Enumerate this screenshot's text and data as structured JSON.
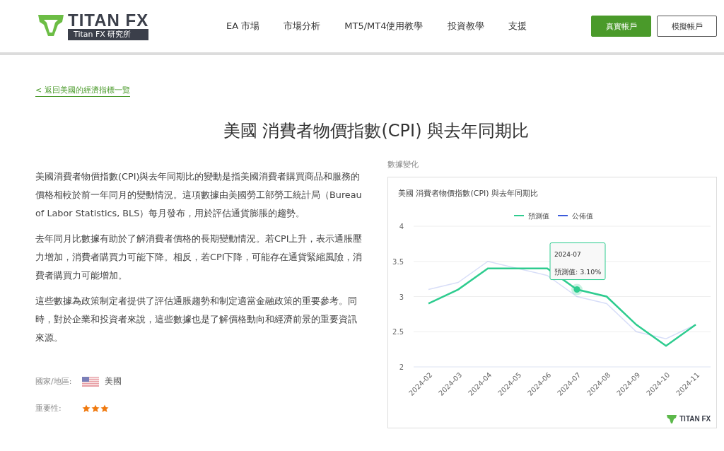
{
  "header": {
    "logo": {
      "brand": "TITAN FX",
      "tagline": "Titan FX 研究所"
    },
    "nav": [
      {
        "label": "EA 市場"
      },
      {
        "label": "市場分析"
      },
      {
        "label": "MT5/MT4使用教學"
      },
      {
        "label": "投資教學"
      },
      {
        "label": "支援"
      }
    ],
    "buttons": [
      {
        "label": "真實帳戶",
        "kind": "primary"
      },
      {
        "label": "模擬帳戶",
        "kind": "outline"
      }
    ]
  },
  "back_link": "< 返回美國的經濟指標一覽",
  "title": "美國 消費者物價指數(CPI) 與去年同期比",
  "paragraphs": [
    "美國消費者物價指數(CPI)與去年同期比的變動是指美國消費者購買商品和服務的價格相較於前一年同月的變動情況。這項數據由美國勞工部勞工統計局（Bureau of Labor Statistics, BLS）每月發布，用於評估通貨膨脹的趨勢。",
    "去年同月比數據有助於了解消費者價格的長期變動情況。若CPI上升，表示通脹壓力增加，消費者購買力可能下降。相反，若CPI下降，可能存在通貨緊縮風險，消費者購買力可能增加。",
    "這些數據為政策制定者提供了評估通脹趨勢和制定適當金融政策的重要參考。同時，對於企業和投資者來說，這些數據也是了解價格動向和經濟前景的重要資訊來源。"
  ],
  "meta": {
    "country_label": "國家/地區:",
    "country": "美國",
    "importance_label": "重要性:",
    "stars": 3
  },
  "chart": {
    "section_label": "數據變化",
    "brand": "TITAN FX",
    "tooltip": {
      "category": "2024-07",
      "text": "預測值: 3.10%"
    },
    "chart_data": {
      "type": "line",
      "title": "美國 消費者物價指數(CPI) 與去年同期比",
      "grid": true,
      "legend": true,
      "categories": [
        "2024-02",
        "2024-03",
        "2024-04",
        "2024-05",
        "2024-06",
        "2024-07",
        "2024-08",
        "2024-09",
        "2024-10",
        "2024-11"
      ],
      "ylim": [
        2,
        4
      ],
      "yticks": [
        2,
        2.5,
        3,
        3.5,
        4
      ],
      "series": [
        {
          "name": "預測值",
          "color": "#2ecc8f",
          "values": [
            2.9,
            3.1,
            3.4,
            3.4,
            3.4,
            3.1,
            3.0,
            2.6,
            2.3,
            2.6
          ]
        },
        {
          "name": "公佈值",
          "color": "#3b5bdb",
          "values": [
            3.1,
            3.2,
            3.5,
            3.4,
            3.3,
            3.0,
            2.9,
            2.5,
            2.4,
            2.6
          ]
        }
      ]
    }
  }
}
